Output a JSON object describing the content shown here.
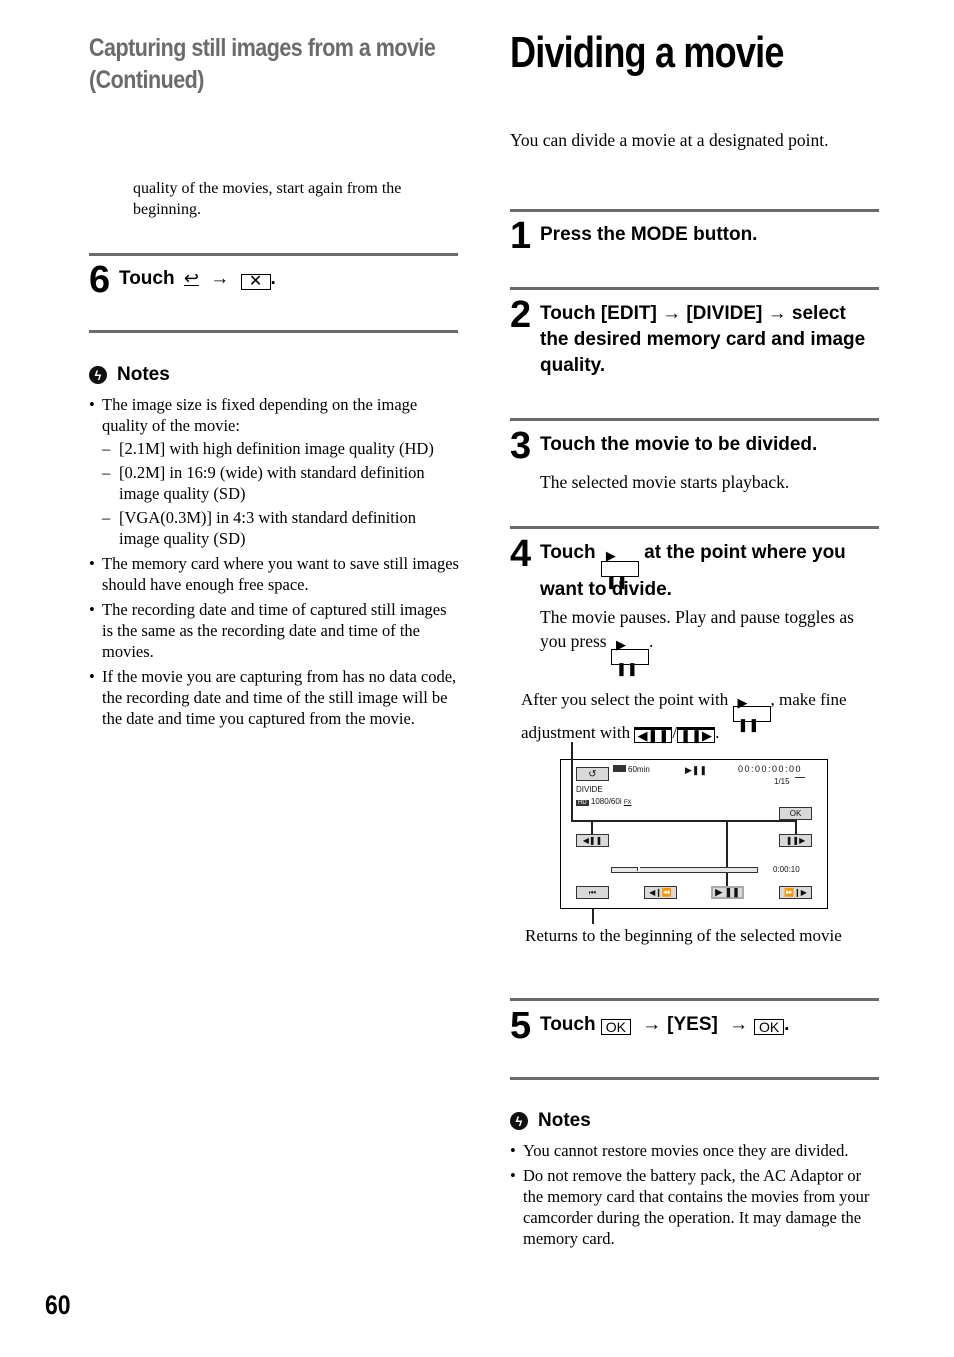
{
  "left": {
    "continued_title": "Capturing still images from a movie (Continued)",
    "carryover_text": "quality of the movies, start again from the beginning.",
    "step6": {
      "number": "6",
      "text": "Touch",
      "back_icon": "return-icon",
      "arrow": "→",
      "close_glyph": "✕",
      "period": "."
    },
    "notes": {
      "heading": "Notes",
      "icon": "notes-icon",
      "items": [
        {
          "text": "The image size is fixed depending on the image quality of the movie:",
          "sub": [
            "[2.1M] with high definition image quality (HD)",
            "[0.2M] in 16:9 (wide) with standard definition image quality (SD)",
            "[VGA(0.3M)] in 4:3 with standard definition image quality (SD)"
          ]
        },
        {
          "text": "The memory card where you want to save still images should have enough free space."
        },
        {
          "text": "The recording date and time of captured still images is the same as the recording date and time of the movies."
        },
        {
          "text": "If the movie you are capturing from has no data code, the recording date and time of the still image will be the date and time you captured from the movie."
        }
      ]
    }
  },
  "right": {
    "title": "Dividing a movie",
    "intro": "You can divide a movie at a designated point.",
    "steps": [
      {
        "number": "1",
        "text": "Press the MODE button."
      },
      {
        "number": "2",
        "text": "Touch [EDIT] → [DIVIDE] → select the desired memory card and image quality."
      },
      {
        "number": "3",
        "text": "Touch the movie to be divided.",
        "detail": "The selected movie starts playback."
      },
      {
        "number": "4",
        "text_before": "Touch",
        "text_after": "at the point where you want to divide.",
        "detail_before": "The movie pauses. Play and pause toggles as you press",
        "detail_after": "."
      },
      {
        "number": "5",
        "text_touch": "Touch",
        "ok_label": "OK",
        "arrow": "→",
        "yes_label": "[YES]",
        "period": "."
      }
    ],
    "hint": {
      "before": "After you select the point with",
      "middle": ", make fine adjustment with",
      "slash": "/",
      "after": "."
    },
    "play_pause_glyph": "▶ ❚❚",
    "step_back_glyph": "◀❚❚",
    "step_forward_glyph": "❚❚▶",
    "screen": {
      "back_glyph": "↺",
      "battery": "60min",
      "play_status": "▶❚❚",
      "timecode": "00:00:00:00",
      "counter": "1/15",
      "media_icon": "memory-card-icon",
      "mode_label": "DIVIDE",
      "quality_badge": "HD",
      "quality": "1080/60i",
      "quality_mode": "FX",
      "ok_label": "OK",
      "step_back": "◀❚❚",
      "step_forward": "❚❚▶",
      "elapsed": "0:00:10",
      "progress_fraction": 0.17,
      "btn_to_start": "⏮",
      "btn_prev": "◀❙⏪",
      "btn_play_pause": "▶ ❚❚",
      "btn_next": "⏩❙▶"
    },
    "caption": "Returns to the beginning of the selected movie",
    "notes": {
      "heading": "Notes",
      "items": [
        "You cannot restore movies once they are divided.",
        "Do not remove the battery pack, the AC Adaptor or the memory card that contains the movies from your camcorder during the operation. It may damage the memory card."
      ]
    }
  },
  "page_number": "60"
}
